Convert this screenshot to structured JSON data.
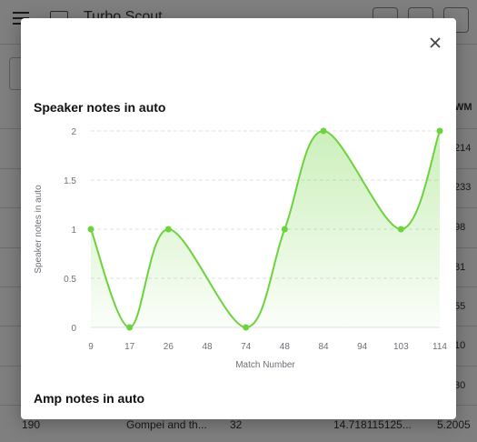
{
  "app": {
    "title": "Turbo Scout"
  },
  "table": {
    "right_values": [
      "WM",
      "214",
      "233",
      "98",
      "81",
      "55",
      "10",
      "30"
    ],
    "last_row": {
      "team": "190",
      "name": "Gompei and th...",
      "matches": "32",
      "value": "14.718115125...",
      "wm": "5.2005"
    }
  },
  "dialog": {
    "chart1_title": "Speaker notes in auto",
    "chart2_title": "Amp notes in auto"
  },
  "chart_data": {
    "type": "line",
    "title": "Speaker notes in auto",
    "xlabel": "Match Number",
    "ylabel": "Speaker notes in auto",
    "categories": [
      "9",
      "17",
      "26",
      "48",
      "74",
      "48",
      "84",
      "94",
      "103",
      "114"
    ],
    "series": [
      {
        "values": [
          1,
          0,
          1,
          null,
          0,
          1,
          2,
          null,
          1,
          2
        ]
      }
    ],
    "ylim": [
      0,
      2
    ],
    "yticks": [
      "0",
      "0.5",
      "1",
      "1.5",
      "2"
    ],
    "smooth": true,
    "area_fill": true,
    "grid": "horizontal-dashed",
    "colors": {
      "line": "#6cd33c",
      "area": "#e8f7dd"
    }
  }
}
